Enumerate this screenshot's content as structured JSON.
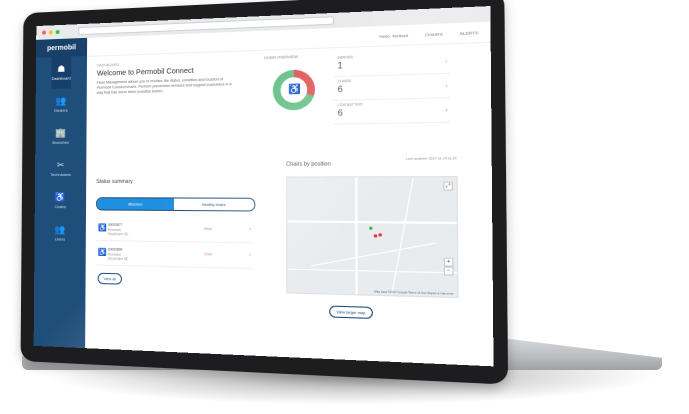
{
  "brand": {
    "logo_text": "permobil",
    "sidebar_color": "#1f4e7a",
    "accent": "#1f8fe0"
  },
  "sidebar": {
    "items": [
      {
        "label": "Dashboard",
        "icon": "dashboard-icon",
        "glyph": "☗",
        "active": true
      },
      {
        "label": "Dealers",
        "icon": "dealers-icon",
        "glyph": "👥",
        "active": false
      },
      {
        "label": "Branches",
        "icon": "branches-icon",
        "glyph": "🏢",
        "active": false
      },
      {
        "label": "Technicians",
        "icon": "technicians-icon",
        "glyph": "✂",
        "active": false
      },
      {
        "label": "Chairs",
        "icon": "chair-icon",
        "glyph": "♿",
        "active": false
      },
      {
        "label": "Users",
        "icon": "users-icon",
        "glyph": "👥",
        "active": false
      }
    ]
  },
  "topbar": {
    "greeting": "Hello, Melissa",
    "item2": "CHAIRS",
    "item3": "ALERTS"
  },
  "welcome": {
    "breadcrumb": "DASHBOARD",
    "title": "Welcome to Permobil Connect",
    "text": "Fleet Management allows you to monitor the status, condition and location of Permobil Connect chairs. Perform preventive services and support customers in a way that has never been possible before."
  },
  "chair_overview": {
    "label": "CHAIR OVERVIEW",
    "colors": {
      "error": "#e05a5a",
      "ok": "#6cc28a"
    },
    "stats": [
      {
        "label": "ERRORS",
        "value": "1"
      },
      {
        "label": "CHAIRS",
        "value": "6"
      },
      {
        "label": "LOW BATTERY",
        "value": "6"
      }
    ]
  },
  "status_summary": {
    "title": "Status summary",
    "tabs": [
      {
        "label": "Attention",
        "active": true
      },
      {
        "label": "Healthy chairs",
        "active": false
      }
    ],
    "rows": [
      {
        "id": "00000877",
        "sub1": "Permobil",
        "sub2": "Stockholm SE",
        "status": "Error"
      },
      {
        "id": "00000896",
        "sub1": "Permobil",
        "sub2": "Stockholm SE",
        "status": "Error"
      }
    ],
    "view_all": "View all"
  },
  "map_section": {
    "title": "Chairs by position",
    "meta": "Last updated: 2017-11-14 11:20",
    "button": "View larger map",
    "attribution": "Map data ©2017 Google   Terms of Use   Report a map error"
  }
}
